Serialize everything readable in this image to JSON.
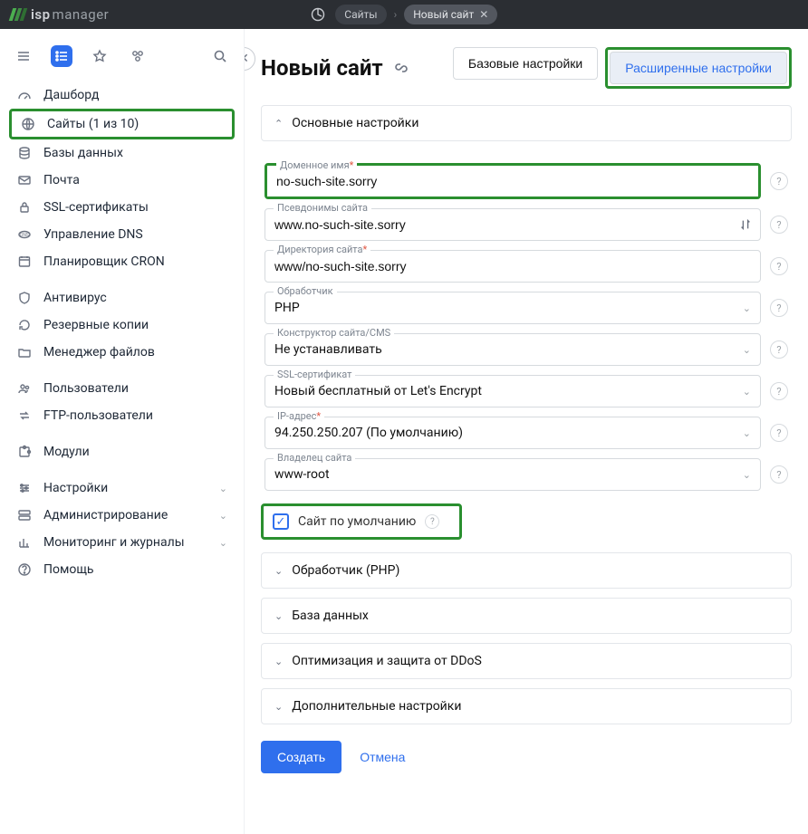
{
  "topbar": {
    "brand_prefix": "isp",
    "brand_suffix": "manager",
    "crumb_sites": "Сайты",
    "crumb_newsite": "Новый сайт"
  },
  "sidebar": {
    "items": [
      {
        "label": "Дашборд"
      },
      {
        "label": "Сайты (1 из 10)"
      },
      {
        "label": "Базы данных"
      },
      {
        "label": "Почта"
      },
      {
        "label": "SSL-сертификаты"
      },
      {
        "label": "Управление DNS"
      },
      {
        "label": "Планировщик CRON"
      },
      {
        "label": "Антивирус"
      },
      {
        "label": "Резервные копии"
      },
      {
        "label": "Менеджер файлов"
      },
      {
        "label": "Пользователи"
      },
      {
        "label": "FTP-пользователи"
      },
      {
        "label": "Модули"
      },
      {
        "label": "Настройки"
      },
      {
        "label": "Администрирование"
      },
      {
        "label": "Мониторинг и журналы"
      },
      {
        "label": "Помощь"
      }
    ]
  },
  "page": {
    "title": "Новый сайт",
    "switch_basic": "Базовые настройки",
    "switch_advanced": "Расширенные настройки",
    "section_main": "Основные настройки",
    "fields": {
      "domain_label": "Доменное имя",
      "domain_value": "no-such-site.sorry",
      "aliases_label": "Псевдонимы сайта",
      "aliases_value": "www.no-such-site.sorry",
      "dir_label": "Директория сайта",
      "dir_value": "www/no-such-site.sorry",
      "handler_label": "Обработчик",
      "handler_value": "PHP",
      "cms_label": "Конструктор сайта/CMS",
      "cms_value": "Не устанавливать",
      "ssl_label": "SSL-сертификат",
      "ssl_value": "Новый бесплатный от Let's Encrypt",
      "ip_label": "IP-адрес",
      "ip_value": "94.250.250.207 (По умолчанию)",
      "owner_label": "Владелец сайта",
      "owner_value": "www-root"
    },
    "default_site_label": "Сайт по умолчанию",
    "section_handler": "Обработчик (PHP)",
    "section_db": "База данных",
    "section_opt": "Оптимизация и защита от DDoS",
    "section_add": "Дополнительные настройки",
    "btn_create": "Создать",
    "btn_cancel": "Отмена"
  }
}
